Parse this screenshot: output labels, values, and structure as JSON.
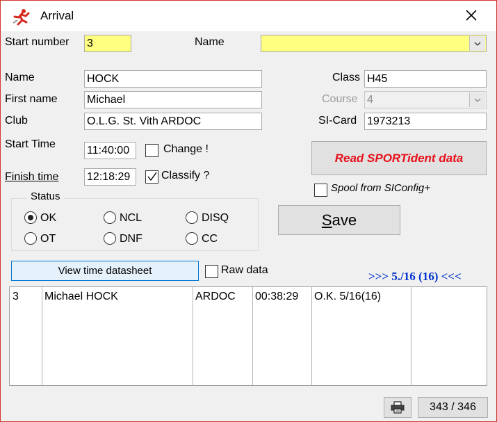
{
  "window": {
    "title": "Arrival"
  },
  "form": {
    "start_number_label": "Start number",
    "start_number_value": "3",
    "name_search_label": "Name",
    "name_search_value": "",
    "name_label": "Name",
    "name_value": "HOCK",
    "first_name_label": "First name",
    "first_name_value": "Michael",
    "club_label": "Club",
    "club_value": "O.L.G. St. Vith ARDOC",
    "class_label": "Class",
    "class_value": "H45",
    "course_label": "Course",
    "course_value": "4",
    "sicard_label": "SI-Card",
    "sicard_value": "1973213",
    "start_time_label": "Start Time",
    "start_time_value": "11:40:00",
    "change_label": "Change !",
    "finish_time_label": "Finish time",
    "finish_time_value": "12:18:29",
    "classify_label": "Classify ?"
  },
  "buttons": {
    "read_sportident": "Read SPORTident data",
    "spool_label": "Spool from SIConfig+",
    "save": "Save",
    "view_datasheet": "View time datasheet",
    "raw_data": "Raw data"
  },
  "status": {
    "title": "Status",
    "options": [
      "OK",
      "NCL",
      "DISQ",
      "OT",
      "DNF",
      "CC"
    ],
    "selected": "OK"
  },
  "results_header": ">>> 5./16 (16) <<<",
  "result_row": {
    "start_number": "3",
    "name": "Michael HOCK",
    "club": "ARDOC",
    "time": "00:38:29",
    "result": "O.K. 5/16(16)"
  },
  "footer": {
    "counter": "343 / 346"
  },
  "icons": {
    "app": "runner-icon",
    "close": "close-icon",
    "printer": "printer-icon",
    "dropdown": "chevron-down-icon",
    "check": "checkmark-icon"
  },
  "colors": {
    "yellow_field": "#ffff80",
    "read_button_text": "#e8101a",
    "results_header": "#0033cc",
    "accent_blue": "#0078d7"
  }
}
